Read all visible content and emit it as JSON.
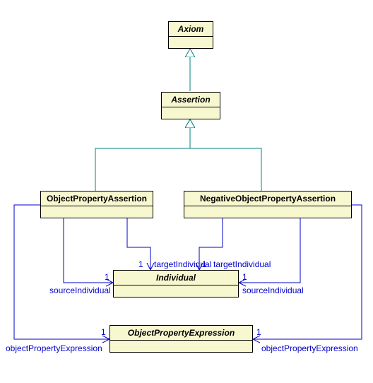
{
  "classes": {
    "axiom": "Axiom",
    "assertion": "Assertion",
    "opa": "ObjectPropertyAssertion",
    "nopa": "NegativeObjectPropertyAssertion",
    "individual": "Individual",
    "ope": "ObjectPropertyExpression"
  },
  "assoc": {
    "targetIndividual": "targetIndividual",
    "sourceIndividual": "sourceIndividual",
    "objectPropertyExpression": "objectPropertyExpression",
    "one": "1"
  }
}
